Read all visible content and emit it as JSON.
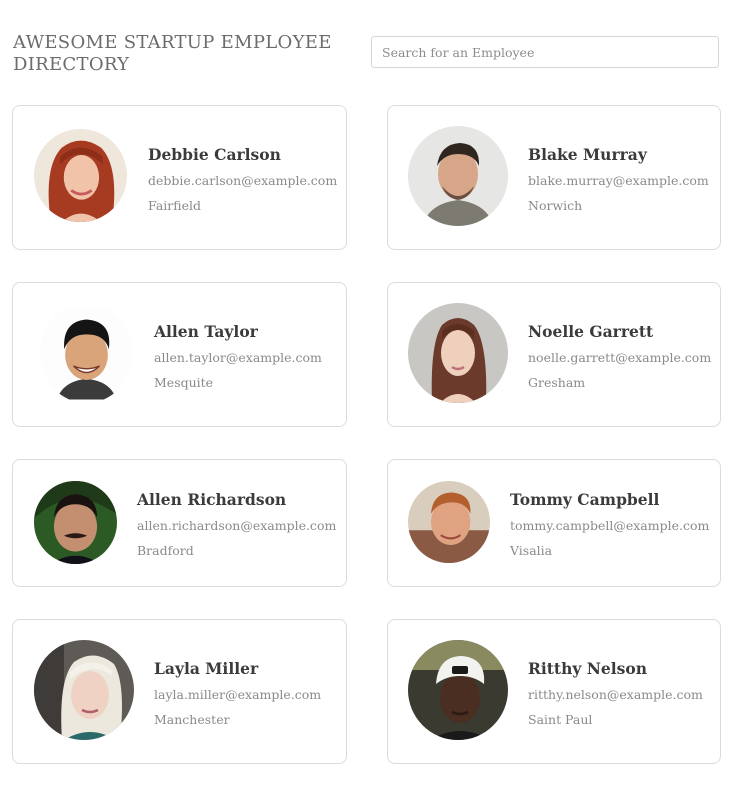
{
  "header": {
    "title": "AWESOME STARTUP EMPLOYEE DIRECTORY",
    "search_placeholder": "Search for an Employee"
  },
  "employees": [
    {
      "name": "Debbie Carlson",
      "email": "debbie.carlson@example.com",
      "city": "Fairfield",
      "avatar": "woman-red-hair",
      "color": "#b04a34"
    },
    {
      "name": "Blake Murray",
      "email": "blake.murray@example.com",
      "city": "Norwich",
      "avatar": "man-dark-hair",
      "color": "#5e5a55"
    },
    {
      "name": "Allen Taylor",
      "email": "allen.taylor@example.com",
      "city": "Mesquite",
      "avatar": "man-smiling",
      "color": "#c99a78"
    },
    {
      "name": "Noelle Garrett",
      "email": "noelle.garrett@example.com",
      "city": "Gresham",
      "avatar": "woman-brown-hair",
      "color": "#7a4a3a"
    },
    {
      "name": "Allen Richardson",
      "email": "allen.richardson@example.com",
      "city": "Bradford",
      "avatar": "man-moustache",
      "color": "#3a2a2a"
    },
    {
      "name": "Tommy Campbell",
      "email": "tommy.campbell@example.com",
      "city": "Visalia",
      "avatar": "man-ginger",
      "color": "#b4603e"
    },
    {
      "name": "Layla Miller",
      "email": "layla.miller@example.com",
      "city": "Manchester",
      "avatar": "woman-blonde",
      "color": "#cfcac0"
    },
    {
      "name": "Ritthy Nelson",
      "email": "ritthy.nelson@example.com",
      "city": "Saint Paul",
      "avatar": "man-white-cap",
      "color": "#2b2320"
    }
  ]
}
